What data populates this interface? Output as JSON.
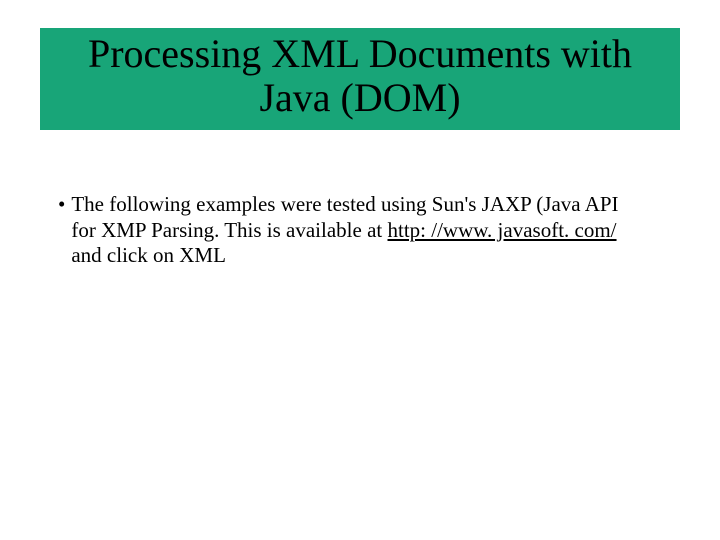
{
  "title": {
    "line1": "Processing XML Documents with",
    "line2": "Java (DOM)"
  },
  "bullet": {
    "text_before_link": "The following examples were tested using Sun's JAXP (Java API for XMP Parsing. This is available at ",
    "link_text": "http: //www. javasoft. com/",
    "text_after_link": " and click on XML"
  }
}
